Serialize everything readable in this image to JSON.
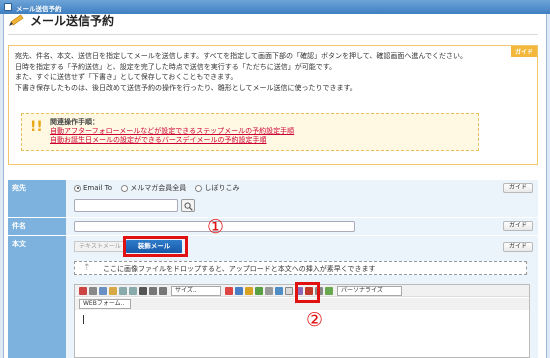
{
  "window": {
    "title": "メール送信予約"
  },
  "page": {
    "title": "メール送信予約"
  },
  "info": {
    "guide_tag": "ガイド",
    "lines": [
      "宛先、件名、本文、送信日を指定してメールを送信します。すべてを指定して画面下部の「確認」ボタンを押して、確認画面へ進んでください。",
      "日時を指定する「予約送信」と、設定を完了した時点で送信を実行する「ただちに送信」が可能です。",
      "また、すぐに送信せず「下書き」として保存しておくこともできます。",
      "下書き保存したものは、後日改めて送信予約の操作を行ったり、雛形としてメール送信に使ったりできます。"
    ],
    "procedure": {
      "title": "関連操作手順：",
      "links": [
        "自動アフターフォローメールなどが設定できるステップメールの予約設定手順",
        "自動お誕生日メールの設定ができるバースデイメールの予約設定手順"
      ]
    }
  },
  "form": {
    "recipient": {
      "label": "宛先",
      "options": [
        {
          "label": "Email To",
          "checked": true
        },
        {
          "label": "メルマガ会員全員",
          "checked": false
        },
        {
          "label": "しぼりこみ",
          "checked": false
        }
      ],
      "guide": "ガイド"
    },
    "subject": {
      "label": "件名",
      "value": "",
      "guide": "ガイド"
    },
    "body": {
      "label": "本文",
      "guide": "ガイド",
      "tab_text": "テキストメール",
      "tab_deco": "装飾メール",
      "drop_hint": "ここに画像ファイルをドロップすると、アップロードと本文への挿入が素早くできます",
      "editor": {
        "size_select": "サイズ..",
        "personalize_select": "パーソナライズ",
        "webform_select": "WEBフォーム..",
        "content": ""
      }
    }
  },
  "annotations": {
    "marker1": "①",
    "marker2": "②",
    "highlight_color": "#e11111"
  }
}
